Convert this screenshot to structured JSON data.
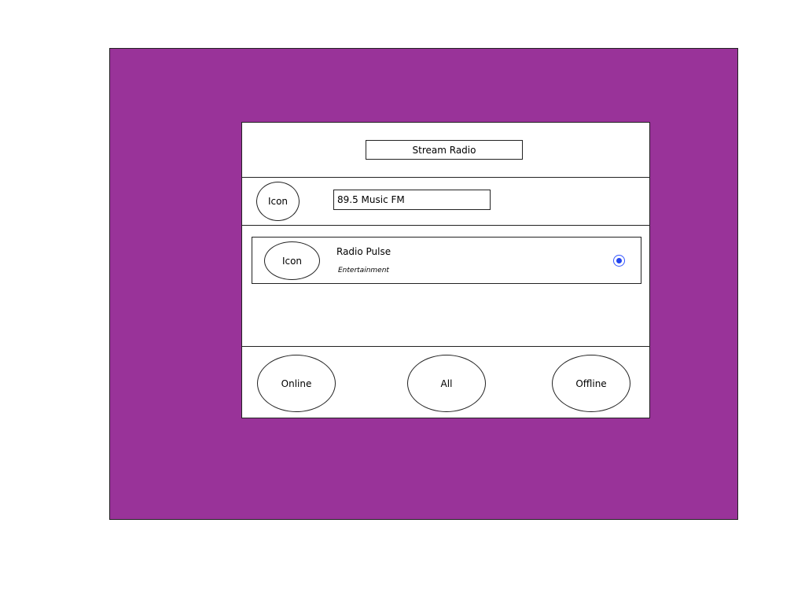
{
  "app": {
    "title": "Stream Radio"
  },
  "colors": {
    "background": "#993399",
    "panel": "#ffffff",
    "radio_accent": "#2244ee"
  },
  "now_playing": {
    "icon_label": "Icon",
    "station_value": "89.5 Music FM"
  },
  "stations": [
    {
      "icon_label": "Icon",
      "name": "Radio Pulse",
      "genre": "Entertainment",
      "selected": true
    }
  ],
  "filters": {
    "online": "Online",
    "all": "All",
    "offline": "Offline"
  }
}
